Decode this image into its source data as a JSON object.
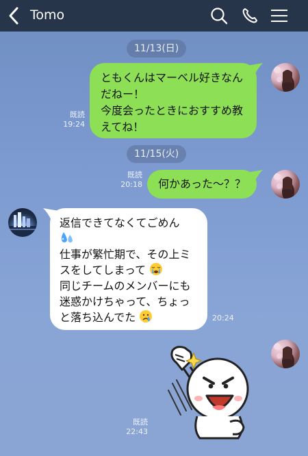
{
  "header": {
    "title": "Tomo",
    "icons": [
      "back-chevron-icon",
      "search-icon",
      "phone-icon",
      "menu-icon"
    ]
  },
  "colors": {
    "header_bg": "#263549",
    "my_bubble": "#8de055",
    "their_bubble": "#ffffff",
    "background": "#7c9ad0"
  },
  "messages": {
    "date1": "11/13(日)",
    "date2": "11/15(火)",
    "m1": {
      "lines": [
        "ともくんはマーベル好きなん",
        "だねー！",
        "今度会ったときにおすすめ教",
        "えてね！"
      ],
      "read": "既読",
      "time": "19:24"
    },
    "m2": {
      "text": "何かあった〜？？",
      "read": "既読",
      "time": "20:18"
    },
    "m3": {
      "lines": [
        "返信できてなくてごめん",
        "",
        "仕事が繁忙期で、その上ミ",
        "スをしてしまって",
        "同じチームのメンバーにも",
        "迷惑かけちゃって、ちょっ",
        "と落ち込んでた"
      ],
      "time": "20:24",
      "emojis": [
        "sweat-drops-emoji",
        "loudly-crying-emoji",
        "crying-face-emoji"
      ]
    },
    "m4": {
      "sticker": "fist-pump-sticker",
      "read": "既読",
      "time": "22:43"
    }
  }
}
